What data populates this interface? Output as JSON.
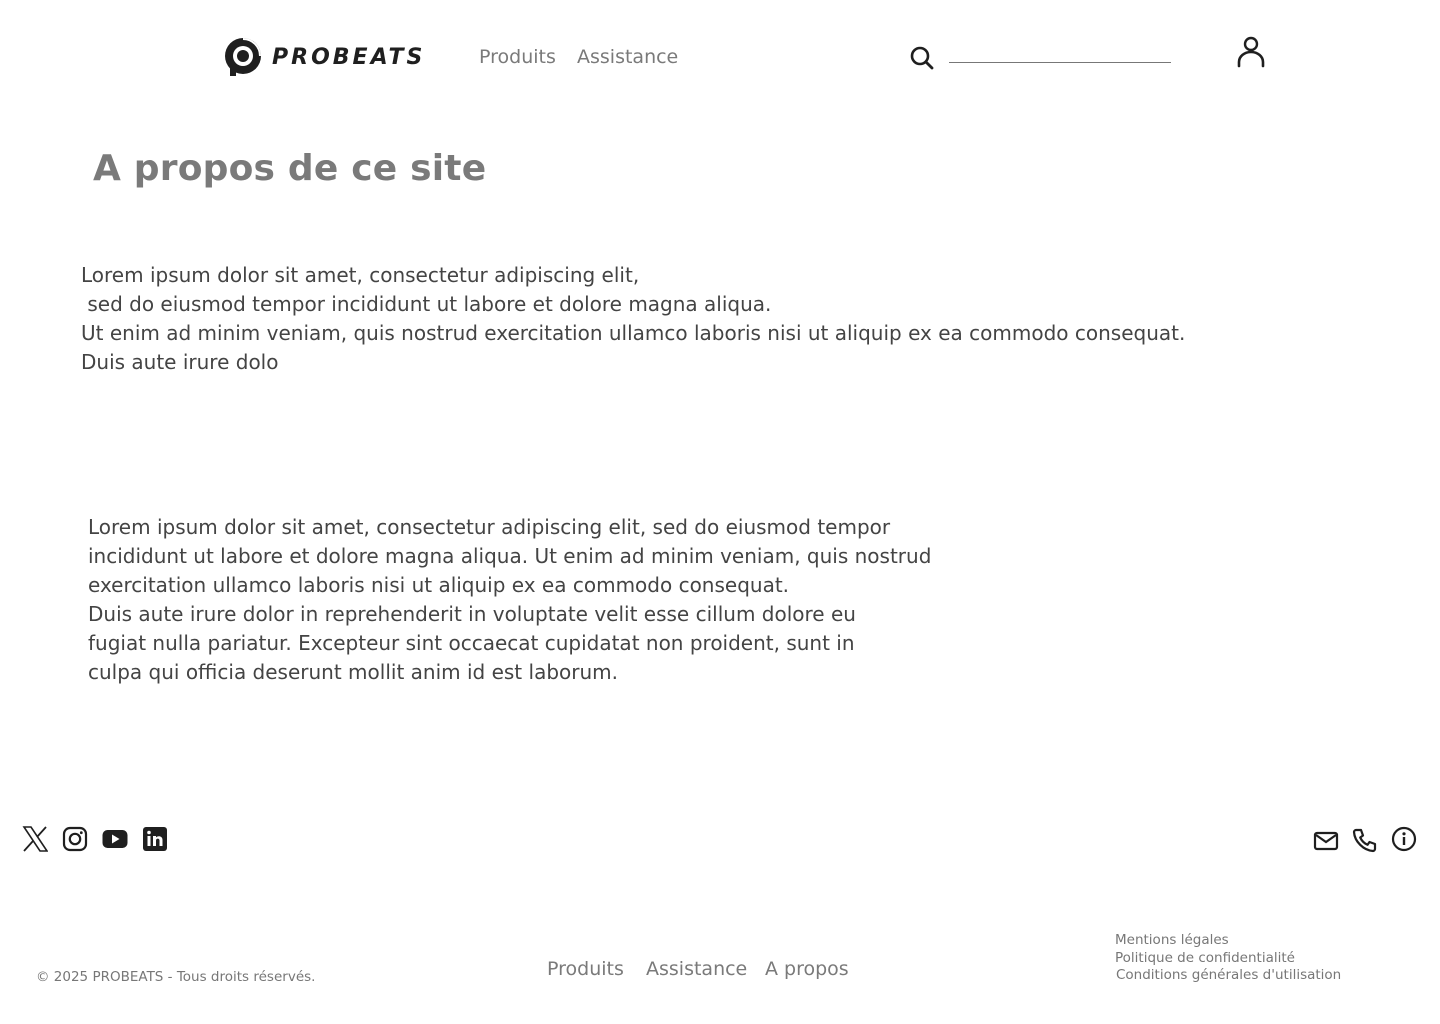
{
  "header": {
    "brand": "PROBEATS",
    "nav": [
      "Produits",
      "Assistance"
    ],
    "search_value": "",
    "icons": {
      "search": "search-icon",
      "user": "user-icon"
    }
  },
  "main": {
    "title": "A propos de ce site",
    "paragraph_1": "Lorem ipsum dolor sit amet, consectetur adipiscing elit,\n sed do eiusmod tempor incididunt ut labore et dolore magna aliqua.\nUt enim ad minim veniam, quis nostrud exercitation ullamco laboris nisi ut aliquip ex ea commodo consequat.\nDuis aute irure dolo",
    "paragraph_2": "Lorem ipsum dolor sit amet, consectetur adipiscing elit, sed do eiusmod tempor\nincididunt ut labore et dolore magna aliqua. Ut enim ad minim veniam, quis nostrud\nexercitation ullamco laboris nisi ut aliquip ex ea commodo consequat.\nDuis aute irure dolor in reprehenderit in voluptate velit esse cillum dolore eu\nfugiat nulla pariatur. Excepteur sint occaecat cupidatat non proident, sunt in\nculpa qui officia deserunt mollit anim id est laborum."
  },
  "footer": {
    "social_icons": [
      "x-icon",
      "instagram-icon",
      "youtube-icon",
      "linkedin-icon"
    ],
    "contact_icons": [
      "mail-icon",
      "phone-icon",
      "info-icon"
    ],
    "copyright": "© 2025 PROBEATS - Tous droits réservés.",
    "nav": [
      "Produits",
      "Assistance",
      "A propos"
    ],
    "legal": [
      "Mentions légales",
      "Politique de confidentialité",
      "Conditions générales d'utilisation"
    ]
  },
  "colors": {
    "text_dark": "#444444",
    "text_muted": "#7a7a7a",
    "brand_black": "#1f1f1f",
    "background": "#ffffff"
  }
}
